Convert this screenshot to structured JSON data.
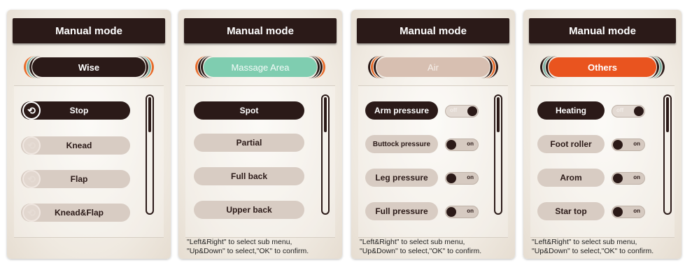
{
  "panels": [
    {
      "title": "Manual mode",
      "category": "Wise",
      "category_color": "#2b1a18",
      "items": [
        {
          "label": "Stop",
          "icon": "swirl-icon",
          "selected": true
        },
        {
          "label": "Knead",
          "icon": "swirl-icon",
          "selected": false
        },
        {
          "label": "Flap",
          "icon": "swirl-icon",
          "selected": false
        },
        {
          "label": "Knead&Flap",
          "icon": "swirl-icon",
          "selected": false
        }
      ]
    },
    {
      "title": "Manual mode",
      "category": "Massage Area",
      "category_color": "#7fcdb0",
      "items": [
        {
          "label": "Spot",
          "selected": true
        },
        {
          "label": "Partial",
          "selected": false
        },
        {
          "label": "Full back",
          "selected": false
        },
        {
          "label": "Upper back",
          "selected": false
        }
      ],
      "help_line1": "\"Left&Right\" to select sub menu,",
      "help_line2": "\"Up&Down\" to select,\"OK\" to confirm."
    },
    {
      "title": "Manual mode",
      "category": "Air",
      "category_color": "#d7bfb1",
      "items": [
        {
          "label": "Arm pressure",
          "selected": true,
          "toggle": "off"
        },
        {
          "label": "Buttock pressure",
          "selected": false,
          "toggle": "on"
        },
        {
          "label": "Leg pressure",
          "selected": false,
          "toggle": "on"
        },
        {
          "label": "Full pressure",
          "selected": false,
          "toggle": "on"
        }
      ],
      "help_line1": "\"Left&Right\" to select sub menu,",
      "help_line2": "\"Up&Down\" to select,\"OK\" to confirm."
    },
    {
      "title": "Manual mode",
      "category": "Others",
      "category_color": "#e9541f",
      "items": [
        {
          "label": "Heating",
          "selected": true,
          "toggle": "off"
        },
        {
          "label": "Foot roller",
          "selected": false,
          "toggle": "on"
        },
        {
          "label": "Arom",
          "selected": false,
          "toggle": "on"
        },
        {
          "label": "Star top",
          "selected": false,
          "toggle": "on"
        }
      ],
      "help_line1": "\"Left&Right\" to select sub menu,",
      "help_line2": "\"Up&Down\" to select,\"OK\" to confirm."
    }
  ]
}
